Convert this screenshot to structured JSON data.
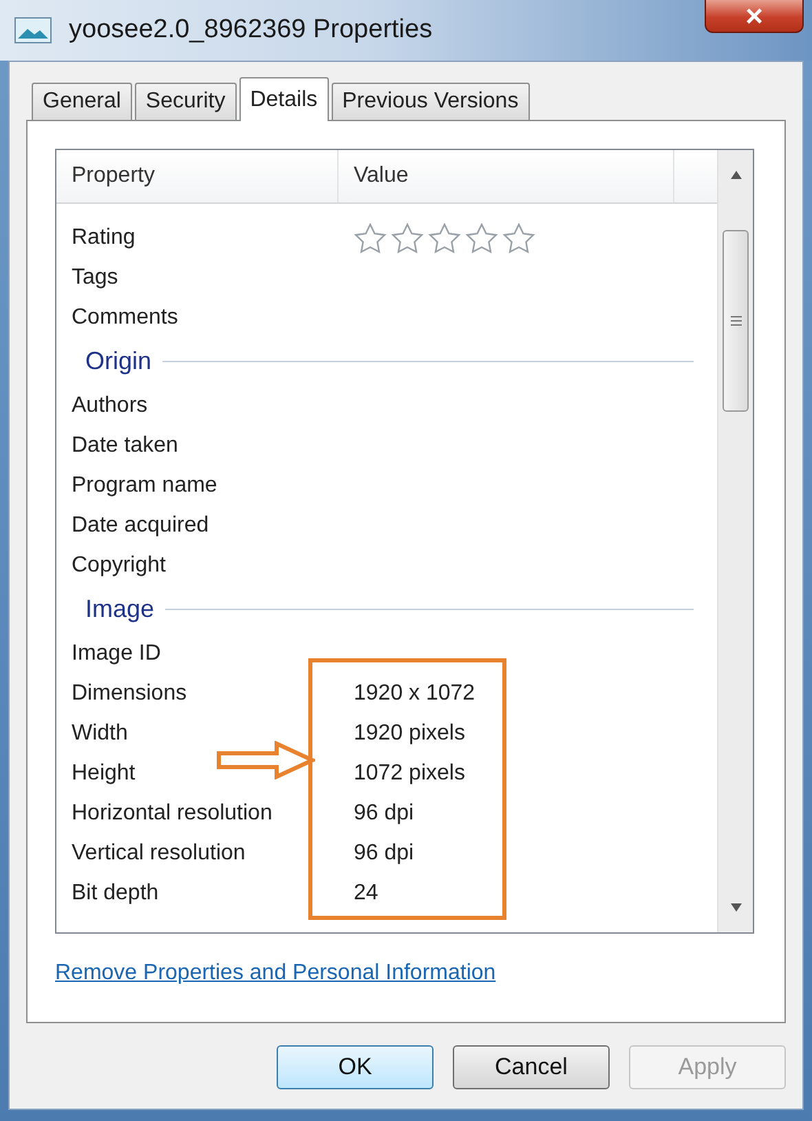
{
  "window": {
    "title": "yoosee2.0_8962369 Properties",
    "close": "×"
  },
  "tabs": [
    {
      "label": "General",
      "selected": false
    },
    {
      "label": "Security",
      "selected": false
    },
    {
      "label": "Details",
      "selected": true
    },
    {
      "label": "Previous Versions",
      "selected": false
    }
  ],
  "table": {
    "columns": [
      "Property",
      "Value"
    ],
    "rows": [
      {
        "kind": "stars",
        "property": "Rating",
        "stars": 0
      },
      {
        "kind": "row",
        "property": "Tags"
      },
      {
        "kind": "row",
        "property": "Comments"
      },
      {
        "kind": "group",
        "property": "Origin"
      },
      {
        "kind": "row",
        "property": "Authors"
      },
      {
        "kind": "row",
        "property": "Date taken"
      },
      {
        "kind": "row",
        "property": "Program name"
      },
      {
        "kind": "row",
        "property": "Date acquired"
      },
      {
        "kind": "row",
        "property": "Copyright"
      },
      {
        "kind": "group",
        "property": "Image"
      },
      {
        "kind": "row",
        "property": "Image ID"
      },
      {
        "kind": "row",
        "property": "Dimensions",
        "value": "1920 x 1072"
      },
      {
        "kind": "row",
        "property": "Width",
        "value": "1920 pixels"
      },
      {
        "kind": "row",
        "property": "Height",
        "value": "1072 pixels"
      },
      {
        "kind": "row",
        "property": "Horizontal resolution",
        "value": "96 dpi"
      },
      {
        "kind": "row",
        "property": "Vertical resolution",
        "value": "96 dpi"
      },
      {
        "kind": "row",
        "property": "Bit depth",
        "value": "24"
      }
    ]
  },
  "link": "Remove Properties and Personal Information",
  "buttons": [
    {
      "label": "OK",
      "disabled": false
    },
    {
      "label": "Cancel",
      "disabled": false
    },
    {
      "label": "Apply",
      "disabled": true
    }
  ]
}
